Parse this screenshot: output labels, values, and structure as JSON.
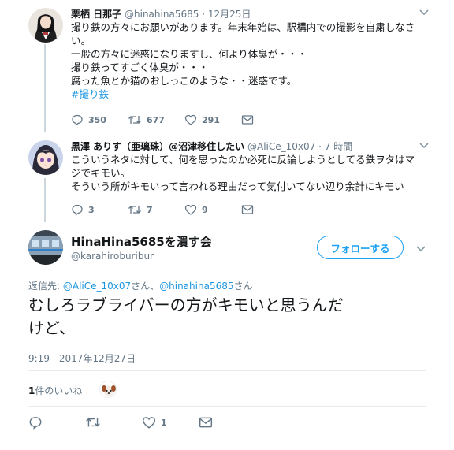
{
  "reply1": {
    "name": "栗栖 日那子",
    "handle": "@hinahina5685",
    "date": "12月25日",
    "lines": [
      "撮り鉄の方々にお願いがあります。年末年始は、駅構内での撮影を自粛しなさ",
      "い。",
      "一般の方々に迷惑になりますし、何より体臭が・・・",
      "撮り鉄ってすごく体臭が・・・",
      "腐った魚とか猫のおしっこのような・・迷惑です。"
    ],
    "hashtag": "#撮り鉄",
    "reply_count": "350",
    "retweet_count": "677",
    "like_count": "291"
  },
  "reply2": {
    "name": "黒澤 ありす（亜璃珠）@沼津移住したい",
    "handle": "@AliCe_10x07",
    "date": "7 時間",
    "lines": [
      "こういうネタに対して、何を思ったのか必死に反論しようとしてる鉄ヲタはマ",
      "ジでキモい。",
      "そういう所がキモいって言われる理由だって気付いてない辺り余計にキモい"
    ],
    "reply_count": "3",
    "retweet_count": "7",
    "like_count": "9"
  },
  "main": {
    "name": "HinaHina5685を潰す会",
    "handle": "@karahiroburibur",
    "follow_label": "フォローする",
    "replying_prefix": "返信先: ",
    "replying_user1": "@AliCe_10x07",
    "replying_mid": "さん、",
    "replying_user2": "@hinahina5685",
    "replying_suffix": "さん",
    "text_line1": "むしろラブライバーの方がキモいと思うんだ",
    "text_line2": "けど、",
    "timestamp": "9:19 - 2017年12月27日",
    "likes_count": "1",
    "likes_suffix": "件のいいね",
    "like_count": "1"
  },
  "colors": {
    "accent": "#1da1f2",
    "link": "#1b95e0",
    "muted": "#657786",
    "divider": "#e6ecf0"
  },
  "icons": [
    "reply-icon",
    "retweet-icon",
    "like-icon",
    "dm-icon",
    "caret-down-icon"
  ]
}
